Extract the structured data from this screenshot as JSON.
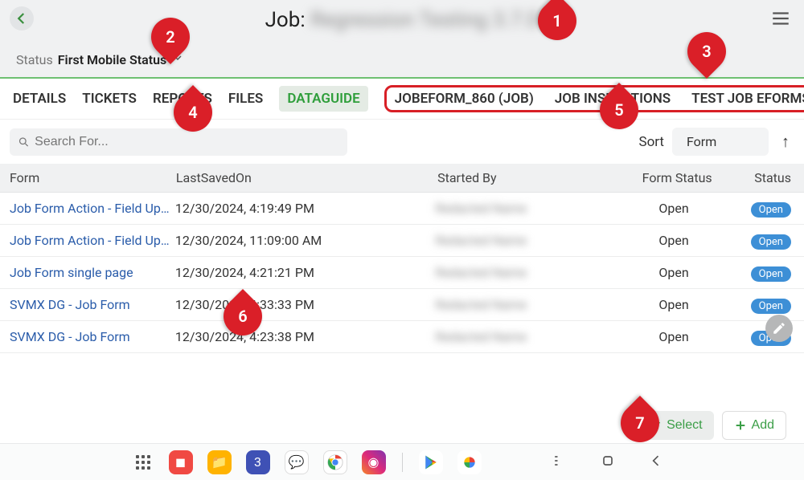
{
  "header": {
    "job_prefix": "Job: ",
    "job_name_redacted": "Regression Testing 3.7.0"
  },
  "status_row": {
    "label": "Status",
    "value": "First Mobile Status"
  },
  "tabs": {
    "items": [
      {
        "label": "DETAILS"
      },
      {
        "label": "TICKETS"
      },
      {
        "label": "REPORTS"
      },
      {
        "label": "FILES"
      },
      {
        "label": "DATAGUIDE",
        "active": true
      }
    ],
    "outlined_group": [
      "JOBEFORM_860 (JOB)",
      "JOB INSPECTIONS",
      "TEST JOB EFORMS"
    ]
  },
  "search": {
    "placeholder": "Search For..."
  },
  "sort": {
    "label": "Sort",
    "value": "Form",
    "direction": "↑"
  },
  "table": {
    "headers": {
      "form": "Form",
      "last_saved": "LastSavedOn",
      "started_by": "Started By",
      "form_status": "Form Status",
      "status": "Status"
    },
    "rows": [
      {
        "form": "Job Form Action - Field Upd…",
        "saved": "12/30/2024, 4:19:49 PM",
        "started_by": "Redacted Name",
        "form_status": "Open",
        "badge": "Open"
      },
      {
        "form": "Job Form Action - Field Upd…",
        "saved": "12/30/2024, 11:09:00 AM",
        "started_by": "Redacted Name",
        "form_status": "Open",
        "badge": "Open"
      },
      {
        "form": "Job Form single page",
        "saved": "12/30/2024, 4:21:21 PM",
        "started_by": "Redacted Name",
        "form_status": "Open",
        "badge": "Open"
      },
      {
        "form": "SVMX DG - Job Form",
        "saved": "12/30/2024, 4:33:33 PM",
        "started_by": "Redacted Name",
        "form_status": "Open",
        "badge": "Open"
      },
      {
        "form": "SVMX DG - Job Form",
        "saved": "12/30/2024, 4:23:38 PM",
        "started_by": "Redacted Name",
        "form_status": "Open",
        "badge": "Open"
      }
    ]
  },
  "actions": {
    "select": "Select",
    "add": "Add"
  },
  "markers": {
    "m1": "1",
    "m2": "2",
    "m3": "3",
    "m4": "4",
    "m5": "5",
    "m6": "6",
    "m7": "7"
  },
  "navbar": {
    "icons": [
      "drawer",
      "red-app",
      "files-app",
      "calendar-app",
      "messages-app",
      "chrome",
      "instagram",
      "sep",
      "play-store",
      "photos"
    ]
  }
}
